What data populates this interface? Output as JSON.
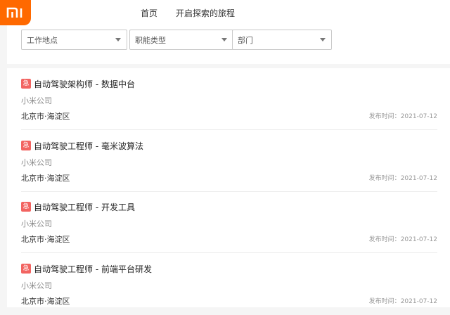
{
  "header": {
    "logo_text": "mi",
    "nav": [
      {
        "label": "首页"
      },
      {
        "label": "开启探索的旅程"
      }
    ]
  },
  "filters": [
    {
      "placeholder": "工作地点"
    },
    {
      "placeholder": "职能类型"
    },
    {
      "placeholder": "部门"
    }
  ],
  "jobs": [
    {
      "badge": "急",
      "title": "自动驾驶架构师 - 数据中台",
      "company": "小米公司",
      "location": "北京市·海淀区",
      "date_label": "发布时间：",
      "date": "2021-07-12"
    },
    {
      "badge": "急",
      "title": "自动驾驶工程师 - 毫米波算法",
      "company": "小米公司",
      "location": "北京市·海淀区",
      "date_label": "发布时间：",
      "date": "2021-07-12"
    },
    {
      "badge": "急",
      "title": "自动驾驶工程师 - 开发工具",
      "company": "小米公司",
      "location": "北京市·海淀区",
      "date_label": "发布时间：",
      "date": "2021-07-12"
    },
    {
      "badge": "急",
      "title": "自动驾驶工程师 - 前端平台研发",
      "company": "小米公司",
      "location": "北京市·海淀区",
      "date_label": "发布时间：",
      "date": "2021-07-12"
    }
  ],
  "colors": {
    "brand": "#ff6900",
    "urgent": "#f26461"
  }
}
